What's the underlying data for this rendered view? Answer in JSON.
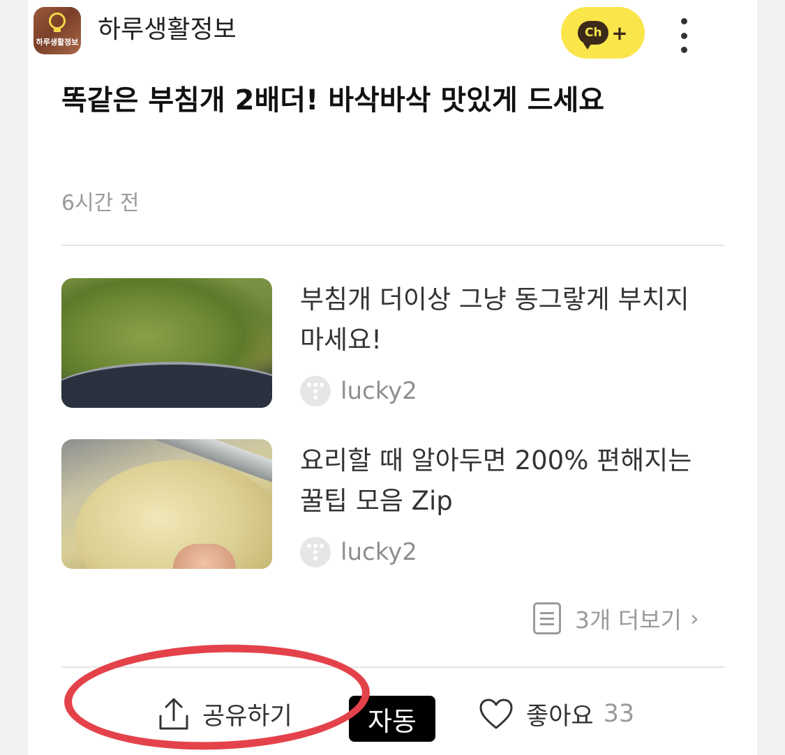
{
  "channel": {
    "name": "하루생활정보",
    "logo_text": "하루생활정보",
    "add_channel_label": "Ch",
    "add_channel_plus": "+"
  },
  "post": {
    "title": "똑같은 부침개 2배더! 바삭바삭 맛있게 드세요",
    "time_ago": "6시간 전"
  },
  "related": [
    {
      "title": "부침개 더이상 그냥 동그랗게 부치지 마세요!",
      "source": "lucky2"
    },
    {
      "title": "요리할 때 알아두면 200% 편해지는 꿀팁 모음 Zip",
      "source": "lucky2"
    }
  ],
  "more_link": {
    "label": "3개 더보기",
    "chevron": "›"
  },
  "actions": {
    "share_label": "공유하기",
    "auto_badge": "자동",
    "like_label": "좋아요",
    "like_count": "33"
  },
  "colors": {
    "kakao_yellow": "#fae54a",
    "highlight_red": "#e4424a"
  },
  "icons": [
    "more-vertical-icon",
    "share-icon",
    "heart-icon",
    "document-icon",
    "chevron-right-icon"
  ]
}
